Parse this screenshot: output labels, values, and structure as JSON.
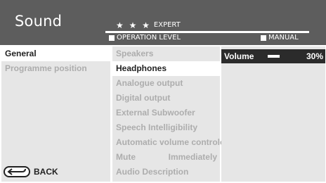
{
  "header": {
    "title": "Sound",
    "level_stars": "★ ★ ★",
    "level_name": "EXPERT",
    "legend_operation": "OPERATION LEVEL",
    "legend_manual": "MANUAL"
  },
  "left_menu": {
    "items": [
      {
        "label": "General",
        "selected": true
      },
      {
        "label": "Programme position",
        "selected": false
      }
    ],
    "back_label": "BACK"
  },
  "middle_menu": {
    "items": [
      {
        "label": "Speakers",
        "value": "",
        "selected": false
      },
      {
        "label": "Headphones",
        "value": "",
        "selected": true
      },
      {
        "label": "Analogue output",
        "value": "",
        "selected": false
      },
      {
        "label": "Digital output",
        "value": "",
        "selected": false
      },
      {
        "label": "External Subwoofer",
        "value": "",
        "selected": false
      },
      {
        "label": "Speech Intelligibility",
        "value": "",
        "selected": false
      },
      {
        "label": "Automatic volume control",
        "value": "on",
        "selected": false
      },
      {
        "label": "Mute",
        "value": "Immediately",
        "selected": false
      },
      {
        "label": "Audio Description",
        "value": "",
        "selected": false
      }
    ]
  },
  "right_panel": {
    "volume_label": "Volume",
    "volume_value": "30%",
    "volume_level": 0.3
  },
  "colors": {
    "header_bg": "#5d5d5d",
    "panel_bg": "#e6e6e6",
    "selected_bg": "#ffffff",
    "highlight_bg": "#2b2b2b",
    "inactive_text": "#adadad",
    "active_text": "#222222"
  },
  "icons": {
    "back": "back-arrow-icon",
    "legend_square": "square-icon"
  }
}
